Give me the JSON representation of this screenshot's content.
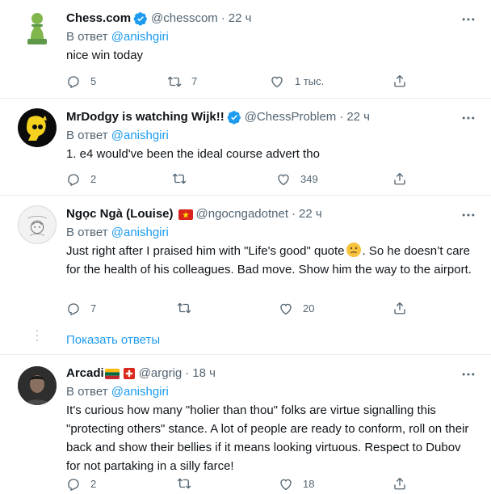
{
  "tweets": [
    {
      "name": "Chess.com",
      "handle": "@chesscom",
      "time": "22 ч",
      "reply_prefix": "В ответ",
      "reply_mention": "@anishgiri",
      "text": "nice win today",
      "replies": "5",
      "retweets": "7",
      "likes": "1 тыс."
    },
    {
      "name": "MrDodgy is watching Wijk!!",
      "handle": "@ChessProblem",
      "time": "22 ч",
      "reply_prefix": "В ответ",
      "reply_mention": "@anishgiri",
      "text": "1. e4 would've been the ideal course advert tho",
      "replies": "2",
      "retweets": "",
      "likes": "349"
    },
    {
      "name": "Ngọc Ngà (Louise)",
      "handle": "@ngocngadotnet",
      "time": "22 ч",
      "reply_prefix": "В ответ",
      "reply_mention": "@anishgiri",
      "text_before_emoji": "Just right after I praised him with \"Life's good\" quote",
      "text_after_emoji": ". So he doesn’t care for the health of his colleagues. Bad move. Show him the way to the airport.",
      "replies": "7",
      "retweets": "",
      "likes": "20",
      "show_replies": "Показать ответы"
    },
    {
      "name": "Arcadi",
      "handle": "@argrig",
      "time": "18 ч",
      "reply_prefix": "В ответ",
      "reply_mention": "@anishgiri",
      "text": "It's curious how many \"holier than thou\" folks are virtue signalling this \"protecting others\" stance. A lot of people are ready to conform, roll on their back and show their bellies if it means looking virtuous. Respect to Dubov for not partaking in a silly farce!",
      "replies": "2",
      "retweets": "",
      "likes": "18"
    }
  ],
  "colors": {
    "accent": "#1d9bf0",
    "secondary_text": "#536471",
    "divider": "#e6ecf0"
  },
  "icons": [
    "chess-pawn-avatar",
    "verified-badge-icon",
    "more-icon",
    "reply-icon",
    "retweet-icon",
    "like-icon",
    "share-icon",
    "vietnam-flag",
    "lithuania-flag",
    "switzerland-flag",
    "slightly-frowning-emoji"
  ]
}
